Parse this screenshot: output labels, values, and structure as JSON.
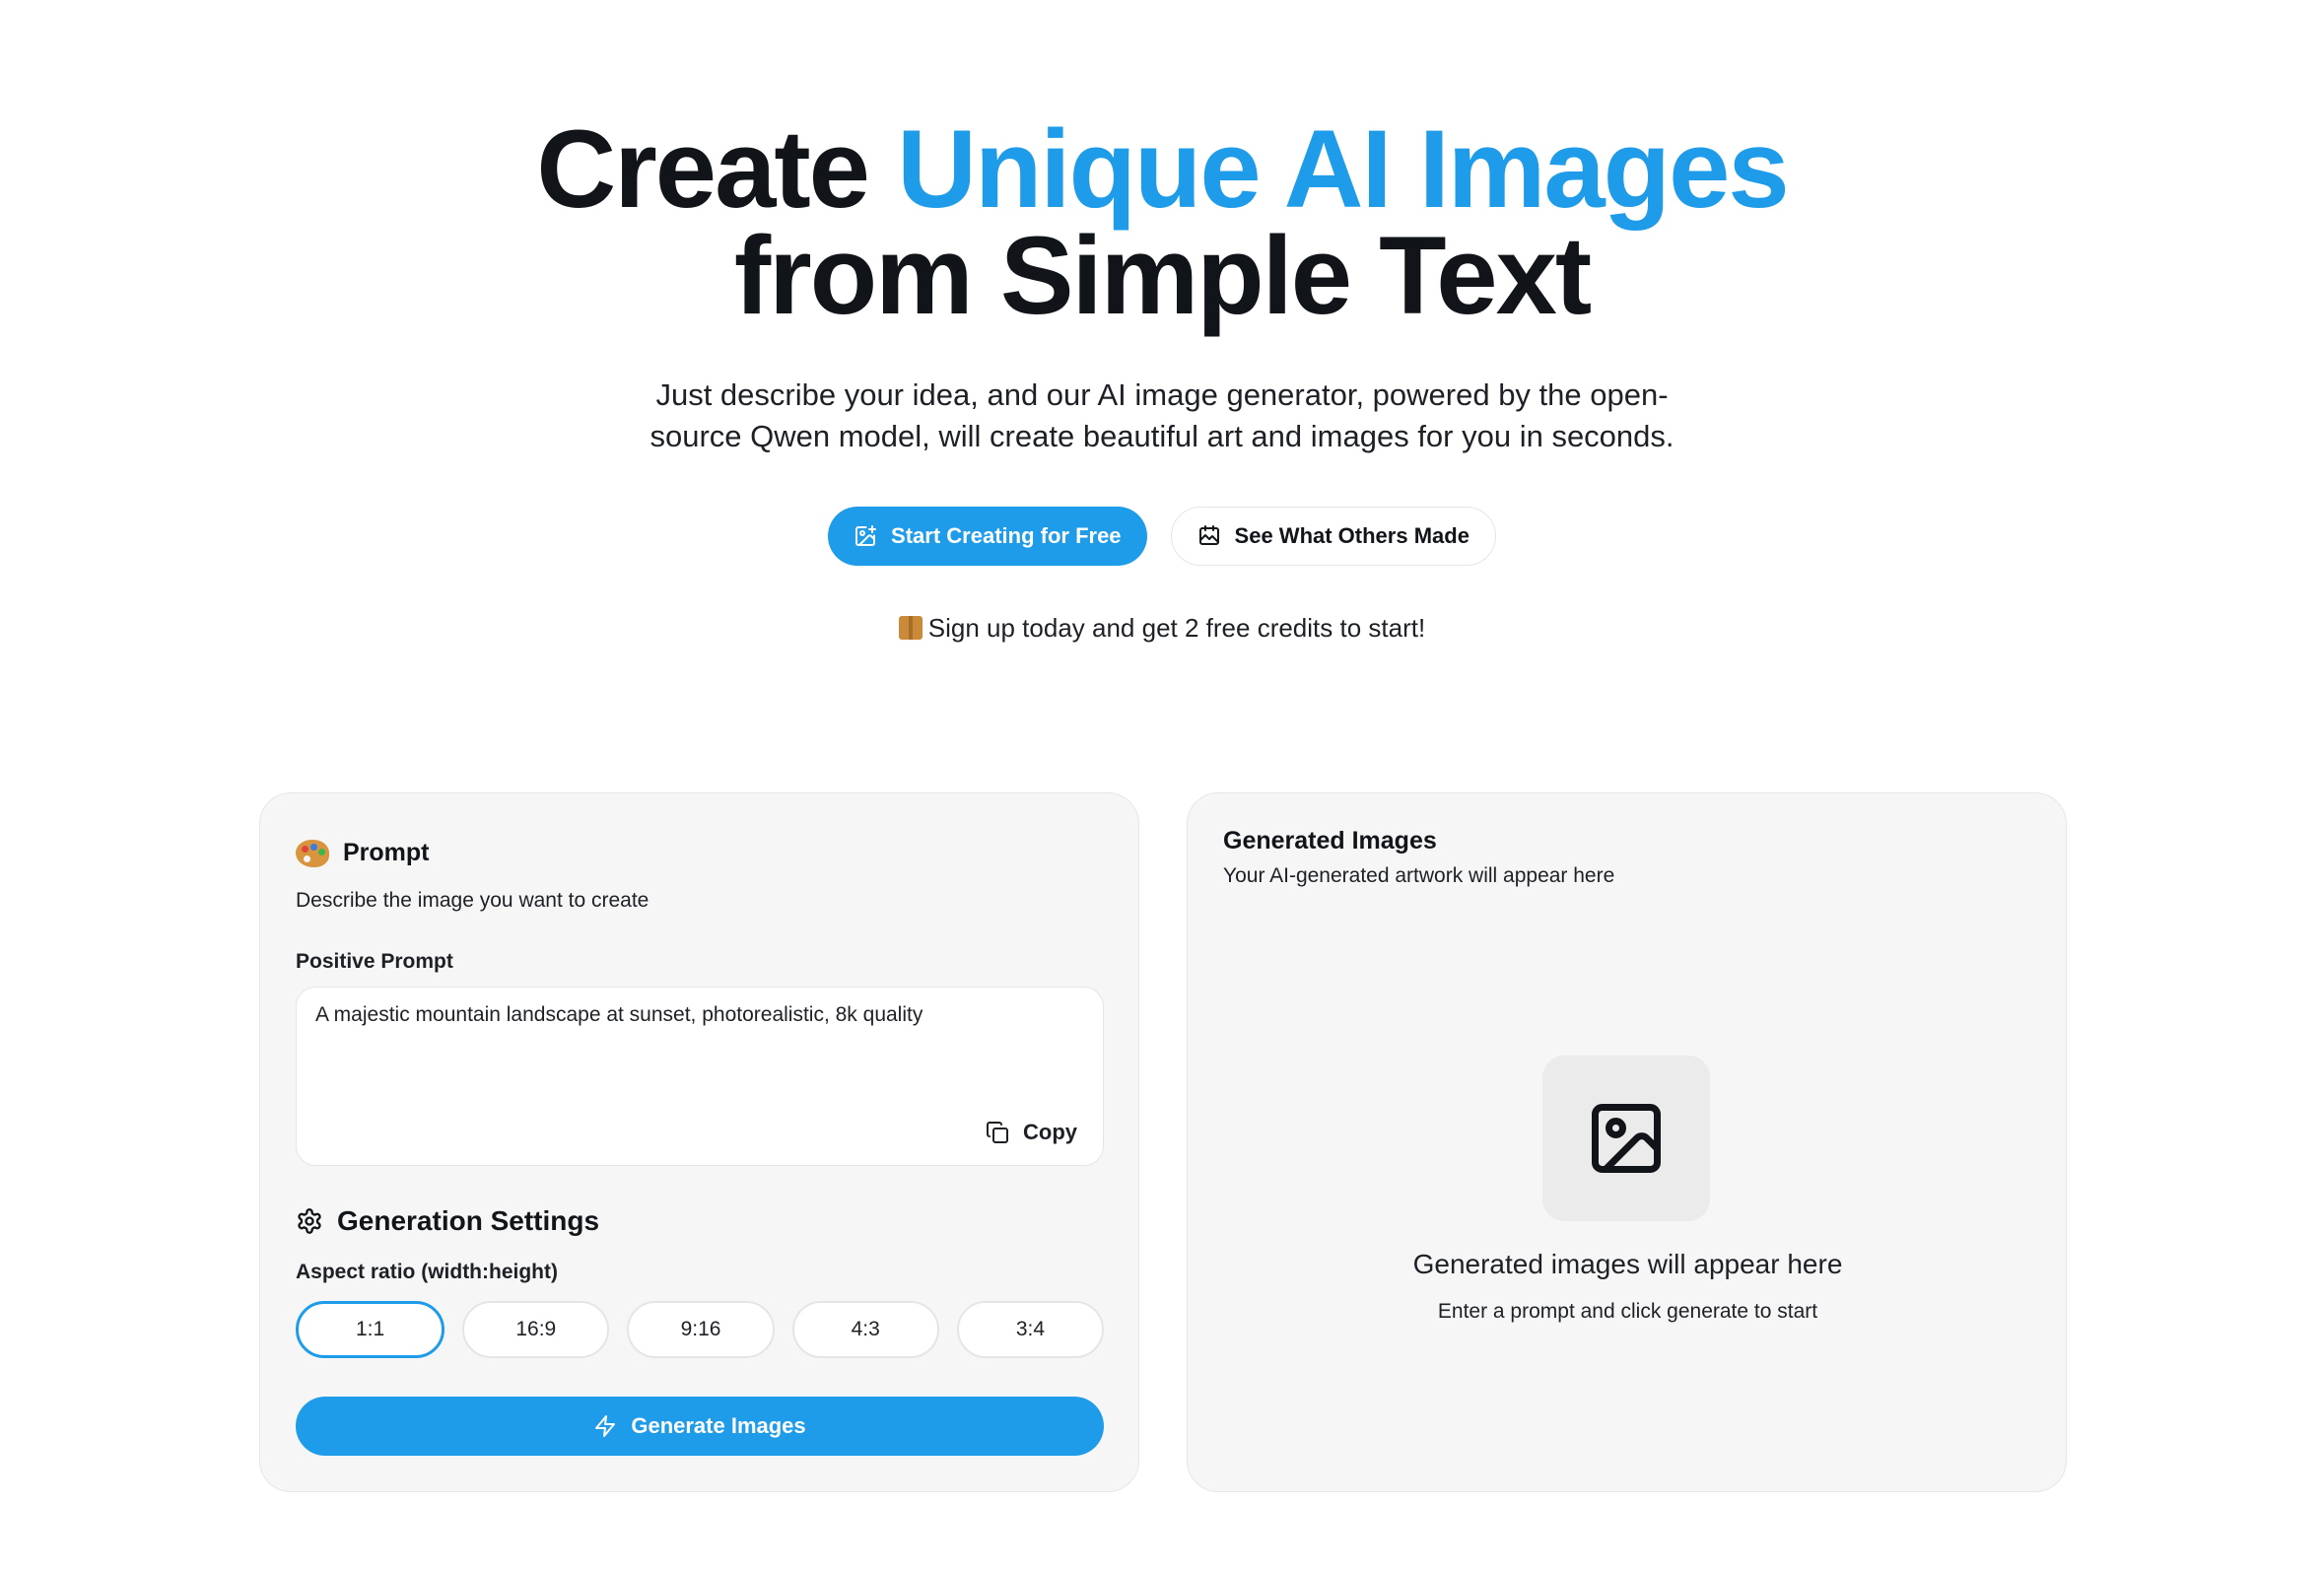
{
  "hero": {
    "title_part1": "Create ",
    "title_accent": "Unique AI Images",
    "title_line2": "from Simple Text",
    "subtitle_line1": "Just describe your idea, and our AI image generator, powered by the open-",
    "subtitle_line2": "source Qwen model, will create beautiful art and images for you in seconds.",
    "primary_cta": "Start Creating for Free",
    "secondary_cta": "See What Others Made",
    "signup_note": "Sign up today and get 2 free credits to start!"
  },
  "prompt_panel": {
    "title": "Prompt",
    "description": "Describe the image you want to create",
    "positive_label": "Positive Prompt",
    "positive_value": "A majestic mountain landscape at sunset, photorealistic, 8k quality",
    "copy_label": "Copy",
    "settings_title": "Generation Settings",
    "aspect_label": "Aspect ratio (width:height)",
    "aspect_options": [
      "1:1",
      "16:9",
      "9:16",
      "4:3",
      "3:4"
    ],
    "aspect_selected": "1:1",
    "generate_label": "Generate Images"
  },
  "output_panel": {
    "title": "Generated Images",
    "subtitle": "Your AI-generated artwork will appear here",
    "empty_title": "Generated images will appear here",
    "empty_subtitle": "Enter a prompt and click generate to start"
  },
  "colors": {
    "accent": "#1e9be9",
    "panel_bg": "#f6f6f6"
  }
}
